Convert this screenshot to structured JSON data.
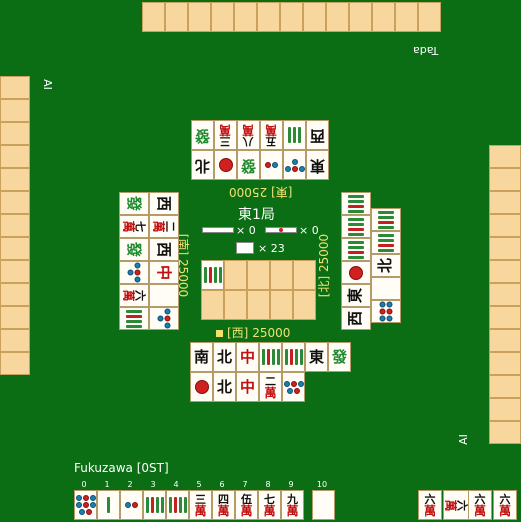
{
  "round": {
    "label": "東1局",
    "honba_count": "× 0",
    "riichi_count": "× 0",
    "wall_remaining": "× 23"
  },
  "players": {
    "top": {
      "name": "Tada",
      "seat": "[東]",
      "score": "25000"
    },
    "left": {
      "name": "AI",
      "seat": "[南]",
      "score": "25000"
    },
    "bottom": {
      "name": "Fukuzawa",
      "status": "[0ST]",
      "seat": "[西]",
      "score": "25000"
    },
    "right": {
      "name": "AI",
      "seat": "[北]",
      "score": "25000"
    }
  },
  "hand_indices": [
    "0",
    "1",
    "2",
    "3",
    "4",
    "5",
    "6",
    "7",
    "8",
    "9",
    "10"
  ],
  "hand": [
    {
      "type": "pin",
      "count": 8
    },
    {
      "type": "sou",
      "count": 1
    },
    {
      "type": "pin",
      "count": 2
    },
    {
      "type": "sou",
      "count": 6
    },
    {
      "type": "sou",
      "count": 8
    },
    {
      "type": "man",
      "num": "三",
      "suit": "萬"
    },
    {
      "type": "man",
      "num": "四",
      "suit": "萬"
    },
    {
      "type": "man",
      "num": "伍",
      "suit": "萬"
    },
    {
      "type": "man",
      "num": "七",
      "suit": "萬"
    },
    {
      "type": "man",
      "num": "九",
      "suit": "萬"
    },
    {
      "type": "blank"
    }
  ],
  "bottom_discards_row1": [
    {
      "type": "honor",
      "char": "南",
      "color": "#111"
    },
    {
      "type": "honor",
      "char": "北",
      "color": "#111"
    },
    {
      "type": "honor",
      "char": "中",
      "color": "#c01010"
    },
    {
      "type": "sou",
      "count": 6
    },
    {
      "type": "sou",
      "count": 8
    },
    {
      "type": "honor",
      "char": "東",
      "color": "#111"
    },
    {
      "type": "honor",
      "char": "發",
      "color": "#1e8a2e"
    }
  ],
  "bottom_discards_row2": [
    {
      "type": "pin",
      "count": 1
    },
    {
      "type": "honor",
      "char": "北",
      "color": "#111"
    },
    {
      "type": "honor",
      "char": "中",
      "color": "#c01010"
    },
    {
      "type": "man",
      "num": "二",
      "suit": "萬"
    },
    {
      "type": "pin",
      "count": 5
    }
  ],
  "top_discards_row1": [
    {
      "type": "honor",
      "char": "西",
      "color": "#111"
    },
    {
      "type": "sou",
      "count": 3
    },
    {
      "type": "man",
      "num": "五",
      "suit": "萬"
    },
    {
      "type": "man",
      "num": "八",
      "suit": "萬"
    },
    {
      "type": "man",
      "num": "三",
      "suit": "萬"
    },
    {
      "type": "honor",
      "char": "發",
      "color": "#1e8a2e"
    }
  ],
  "top_discards_row2": [
    {
      "type": "honor",
      "char": "東",
      "color": "#111"
    },
    {
      "type": "pin",
      "count": 4
    },
    {
      "type": "pin",
      "count": 2
    },
    {
      "type": "honor",
      "char": "發",
      "color": "#1e8a2e"
    },
    {
      "type": "pin",
      "count": 1
    },
    {
      "type": "honor",
      "char": "北",
      "color": "#111"
    }
  ],
  "left_discards_col1": [
    {
      "type": "honor",
      "char": "發",
      "color": "#1e8a2e"
    },
    {
      "type": "man",
      "num": "七",
      "suit": "萬"
    },
    {
      "type": "honor",
      "char": "發",
      "color": "#1e8a2e"
    },
    {
      "type": "pin",
      "count": 4
    },
    {
      "type": "man",
      "num": "六",
      "suit": "萬"
    },
    {
      "type": "sou",
      "count": 6
    }
  ],
  "left_discards_col2": [
    {
      "type": "honor",
      "char": "西",
      "color": "#111"
    },
    {
      "type": "man",
      "num": "二",
      "suit": "萬"
    },
    {
      "type": "honor",
      "char": "西",
      "color": "#111"
    },
    {
      "type": "honor",
      "char": "中",
      "color": "#c01010"
    },
    {
      "type": "blank"
    },
    {
      "type": "pin",
      "count": 4
    }
  ],
  "right_discards_col1": [
    {
      "type": "sou",
      "count": 8
    },
    {
      "type": "sou",
      "count": 6
    },
    {
      "type": "sou",
      "count": 4
    },
    {
      "type": "pin",
      "count": 1
    },
    {
      "type": "honor",
      "char": "東",
      "color": "#111"
    },
    {
      "type": "honor",
      "char": "西",
      "color": "#111"
    }
  ],
  "right_discards_col2": [
    {
      "type": "sou",
      "count": 6
    },
    {
      "type": "sou",
      "count": 5
    },
    {
      "type": "honor",
      "char": "北",
      "color": "#111"
    },
    {
      "type": "blank"
    },
    {
      "type": "pin",
      "count": 6
    }
  ],
  "dora_indicator": {
    "type": "sou",
    "count": 4
  },
  "right_corner_meld": [
    {
      "type": "man",
      "num": "六",
      "suit": "萬"
    },
    {
      "type": "man",
      "num": "六",
      "suit": "萬"
    },
    {
      "type": "man",
      "num": "六",
      "suit": "萬"
    },
    {
      "type": "man",
      "num": "六",
      "suit": "萬"
    }
  ],
  "colors": {
    "table": "#0b6e14",
    "tile_back": "#f7d79e",
    "label": "#f0e070",
    "man_red": "#c01010",
    "pin_blue": "#1a7fb0",
    "sou_green": "#2a8a3a"
  }
}
